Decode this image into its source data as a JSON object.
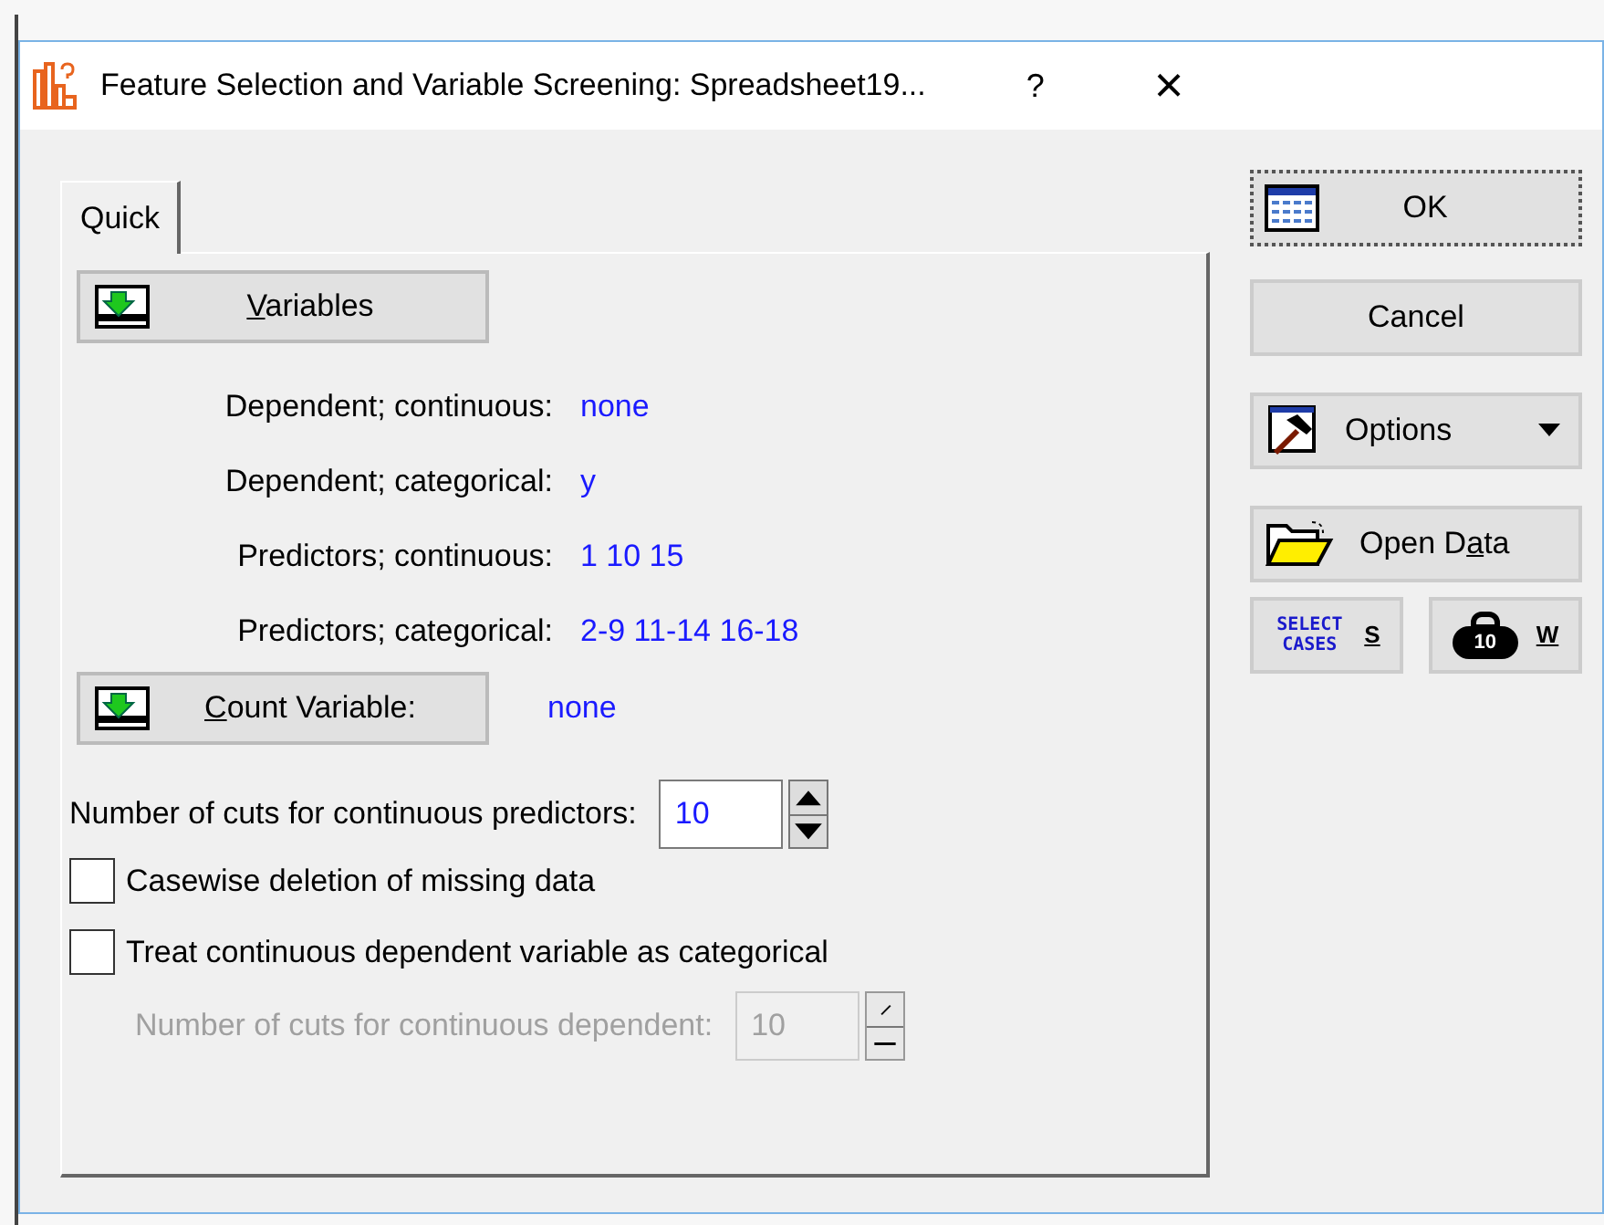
{
  "window": {
    "title": "Feature Selection and Variable Screening: Spreadsheet19...",
    "help": "?",
    "close": "×"
  },
  "tabs": [
    {
      "label": "Quick",
      "selected": true
    }
  ],
  "variables_button": {
    "label": {
      "mnemonic": "V",
      "after": "ariables"
    }
  },
  "assignments": [
    {
      "label": "Dependent; continuous:",
      "value": "none"
    },
    {
      "label": "Dependent; categorical:",
      "value": "y"
    },
    {
      "label": "Predictors; continuous:",
      "value": "1 10 15"
    },
    {
      "label": "Predictors; categorical:",
      "value": "2-9 11-14 16-18"
    }
  ],
  "count_variable": {
    "label": {
      "mnemonic": "C",
      "after": "ount Variable:"
    },
    "value": "none"
  },
  "cuts_predictors": {
    "label": "Number of cuts for continuous predictors:",
    "value": "10",
    "disabled": false
  },
  "checkboxes": [
    {
      "label": "Casewise deletion of missing data",
      "checked": false
    },
    {
      "label": "Treat continuous dependent variable as categorical",
      "checked": false
    }
  ],
  "cuts_dependent": {
    "label": "Number of cuts for continuous dependent:",
    "value": "10",
    "disabled": true
  },
  "side_buttons": [
    {
      "kind": "ok",
      "label": {
        "text": "OK"
      }
    },
    {
      "kind": "plain",
      "label": {
        "text": "Cancel"
      }
    },
    {
      "kind": "options",
      "label": {
        "text": "Options"
      }
    },
    {
      "kind": "open",
      "label": {
        "before": "Open D",
        "mnemonic": "a",
        "after": "ta"
      }
    }
  ],
  "small_buttons": [
    {
      "kind": "select",
      "caption": "SELECT CASES",
      "label": "S"
    },
    {
      "kind": "weight",
      "caption": "10",
      "label": "W"
    }
  ]
}
